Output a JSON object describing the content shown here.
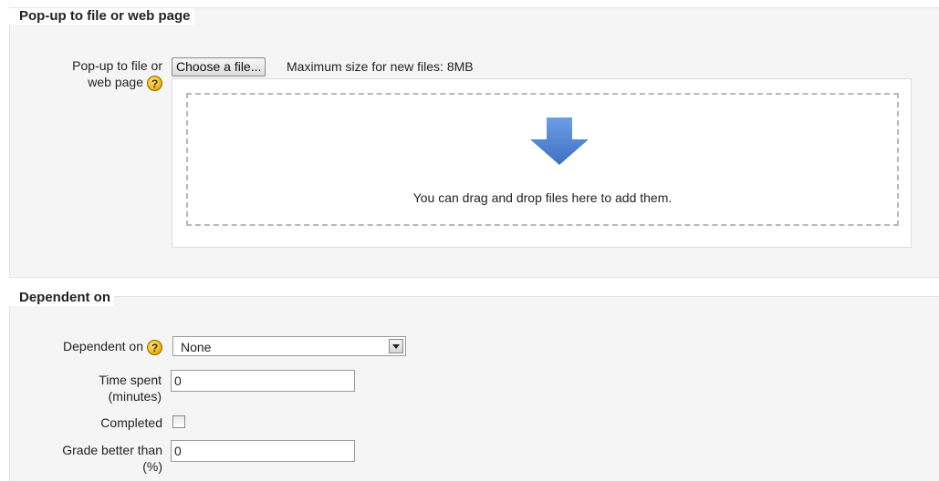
{
  "section_popup": {
    "legend": "Pop-up to file or web page",
    "field_label_line1": "Pop-up to file or",
    "field_label_line2": "web page",
    "help_icon_glyph": "?",
    "choose_button": "Choose a file...",
    "max_size": "Maximum size for new files: 8MB",
    "drop_text": "You can drag and drop files here to add them.",
    "arrow_icon": "down-arrow-icon",
    "arrow_color": "#4a7fd0"
  },
  "section_dependent": {
    "legend": "Dependent on",
    "dependent_label": "Dependent on",
    "help_icon_glyph": "?",
    "dependent_value": "None",
    "time_label_line1": "Time spent",
    "time_label_line2": "(minutes)",
    "time_value": "0",
    "completed_label": "Completed",
    "completed_checked": false,
    "grade_label_line1": "Grade better than",
    "grade_label_line2": "(%)",
    "grade_value": "0"
  }
}
